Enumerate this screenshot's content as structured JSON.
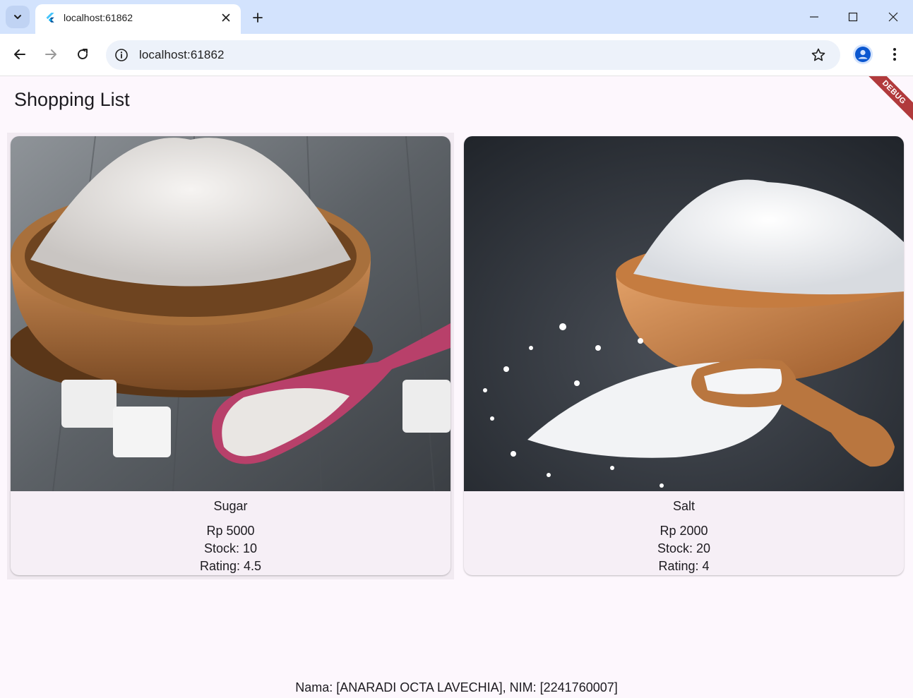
{
  "browser": {
    "tab_title": "localhost:61862",
    "url": "localhost:61862"
  },
  "app": {
    "title": "Shopping List",
    "debug_banner": "DEBUG",
    "products": [
      {
        "name": "Sugar",
        "price": "Rp 5000",
        "stock": "Stock: 10",
        "rating": "Rating: 4.5"
      },
      {
        "name": "Salt",
        "price": "Rp 2000",
        "stock": "Stock: 20",
        "rating": "Rating: 4"
      }
    ],
    "footer": "Nama: [ANARADI OCTA LAVECHIA], NIM: [2241760007]"
  },
  "colors": {
    "tabstrip": "#d3e3fd",
    "app_background": "#fdf7fd",
    "card_background": "#f6eff6",
    "debug_banner": "#b13a3c",
    "sugar_scoop": "#b8406a"
  }
}
